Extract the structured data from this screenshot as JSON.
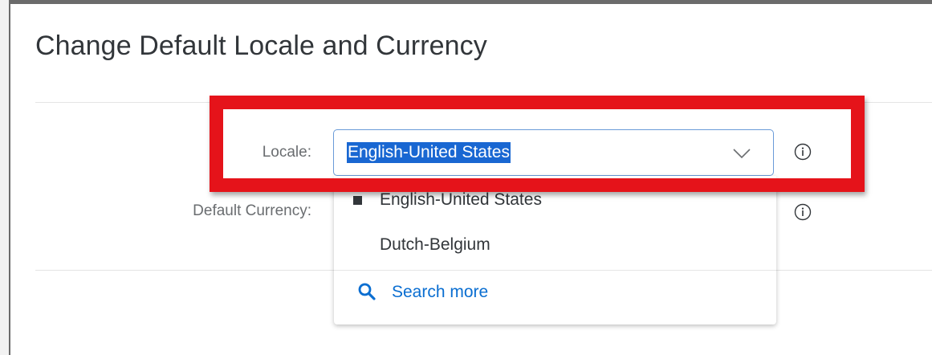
{
  "dialog": {
    "title": "Change Default Locale and Currency"
  },
  "form": {
    "locale_label": "Locale:",
    "locale_value": "English-United States",
    "currency_label": "Default Currency:"
  },
  "dropdown": {
    "options": [
      {
        "label": "English-United States",
        "selected": true
      },
      {
        "label": "Dutch-Belgium",
        "selected": false
      }
    ],
    "search_more_label": "Search more"
  },
  "icons": {
    "chevron": "chevron-down-icon",
    "info": "info-icon",
    "search": "search-icon"
  },
  "colors": {
    "annotation": "#e5131a",
    "selection": "#1967d2",
    "link": "#0a6ed1"
  }
}
